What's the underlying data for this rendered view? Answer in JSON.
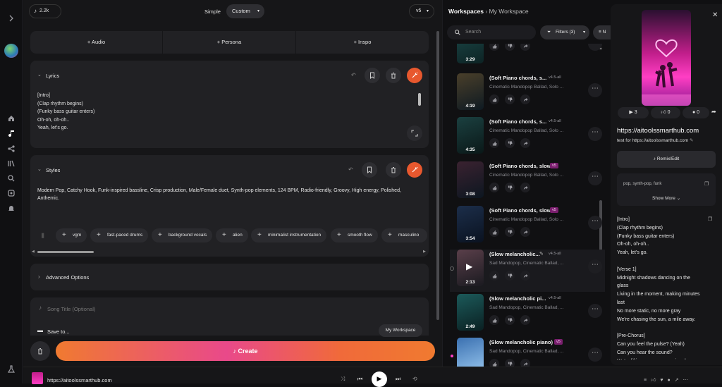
{
  "sidebar": {
    "expand_icon": "chevron-right-icon"
  },
  "create": {
    "credits": "2.2k",
    "mode_simple": "Simple",
    "mode_custom": "Custom",
    "model": "v5",
    "tabs": [
      "Audio",
      "Persona",
      "Inspo"
    ],
    "lyrics": {
      "label": "Lyrics",
      "lines": [
        "[Intro]",
        "(Clap rhythm begins)",
        "(Funky bass guitar enters)",
        "Oh-oh, oh-oh..",
        "Yeah, let's go."
      ]
    },
    "styles": {
      "label": "Styles",
      "text": "Modern Pop, Catchy Hook, Funk-inspired bassline, Crisp production, Male/Female duet, Synth-pop elements, 124 BPM, Radio-friendly, Groovy, High energy, Polished, Anthemic.",
      "tags": [
        "vgm",
        "fast-paced drums",
        "background vocals",
        "alien",
        "minimalist instrumentation",
        "smooth flow",
        "masculino"
      ]
    },
    "advanced": "Advanced Options",
    "song_title_placeholder": "Song Title (Optional)",
    "save_to": "Save to...",
    "workspace_btn": "My Workspace",
    "create_btn": "Create"
  },
  "library": {
    "breadcrumb_root": "Workspaces",
    "breadcrumb_current": "My Workspace",
    "search_placeholder": "Search",
    "filters": "Filters (3)",
    "sort_partial": "N",
    "songs": [
      {
        "title": "",
        "subtitle": "",
        "version": "",
        "duration": "3:29",
        "color1": "#1c4a4a",
        "color2": "#0d2324"
      },
      {
        "title": "(Soft Piano chords, s...",
        "subtitle": "Cinematic Mandopop Ballad, Solo ...",
        "version": "v4.5-all",
        "duration": "4:19",
        "color1": "#4a3f2a",
        "color2": "#0e1a22"
      },
      {
        "title": "(Soft Piano chords, s...",
        "subtitle": "Cinematic Mandopop Ballad, Solo ...",
        "version": "v4.5-all",
        "duration": "4:35",
        "color1": "#1b4040",
        "color2": "#0a1818"
      },
      {
        "title": "(Soft Piano chords, slow ...",
        "subtitle": "Cinematic Mandopop Ballad, Solo ...",
        "version": "v5",
        "duration": "3:08",
        "color1": "#3a2230",
        "color2": "#0c1620"
      },
      {
        "title": "(Soft Piano chords, slow ...",
        "subtitle": "Cinematic Mandopop Ballad, Solo ...",
        "version": "v5",
        "duration": "3:54",
        "color1": "#1c2e4a",
        "color2": "#0a1220"
      },
      {
        "title": "(Slow melancholic...",
        "subtitle": "Sad Mandopop, Cinematic Ballad, ...",
        "version": "v4.5-all",
        "duration": "2:13",
        "color1": "#5a3f4a",
        "color2": "#1a1a20"
      },
      {
        "title": "(Slow melancholic pi...",
        "subtitle": "Sad Mandopop, Cinematic Ballad, ...",
        "version": "v4.5-all",
        "duration": "2:49",
        "color1": "#1c5a5a",
        "color2": "#0a2022"
      },
      {
        "title": "(Slow melancholic piano)",
        "subtitle": "Sad Mandopop, Cinematic Ballad, ...",
        "version": "v5",
        "duration": "",
        "color1": "#3a70b0",
        "color2": "#9ac8f0"
      }
    ]
  },
  "detail": {
    "plays": "3",
    "likes": "0",
    "comments": "0",
    "title": "https://aitoolssmarthub.com",
    "desc": "test for https://aitoolssmarthub.com",
    "remix": "Remix/Edit",
    "tags": "pop, synth-pop, funk",
    "show_more": "Show More",
    "lyrics": [
      "[Intro]",
      "(Clap rhythm begins)",
      "(Funky bass guitar enters)",
      "Oh-oh, oh-oh..",
      "Yeah, let's go.",
      "",
      "[Verse 1]",
      "Midnight shadows dancing on the",
      "glass",
      "Living in the moment, making minutes",
      "last",
      "No more static, no more gray",
      "We're chasing the sun, a mile away.",
      "",
      "[Pre-Chorus]",
      "Can you feel the pulse? (Yeah)",
      "Can you hear the sound?",
      "We're lifting up, never coming down"
    ]
  },
  "player": {
    "title": "https://aitoolssmarthub.com"
  }
}
